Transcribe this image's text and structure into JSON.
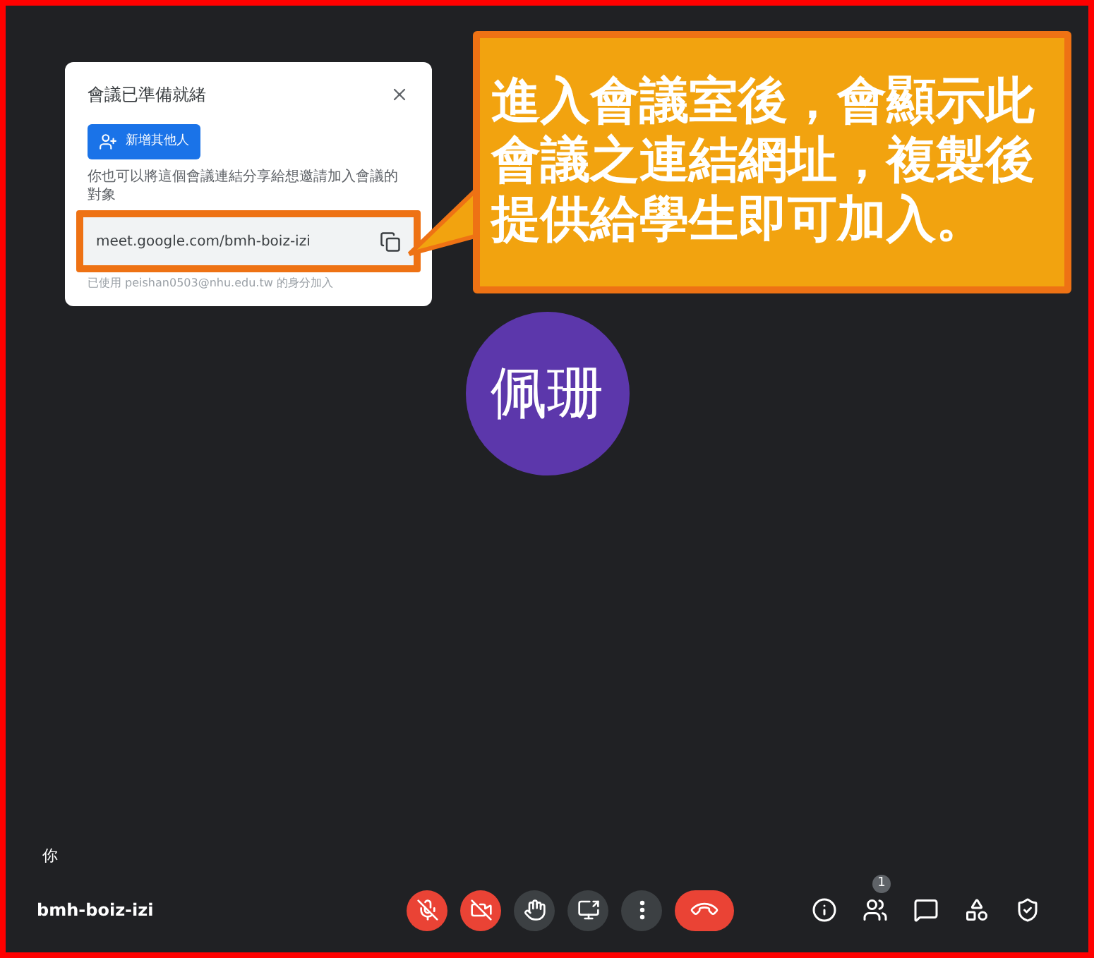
{
  "meeting_ready_card": {
    "title": "會議已準備就緒",
    "add_button": "新增其他人",
    "description": "你也可以將這個會議連結分享給想邀請加入會議的對象",
    "link": "meet.google.com/bmh-boiz-izi",
    "signed_in_note": "已使用 peishan0503@nhu.edu.tw 的身分加入"
  },
  "annotation": {
    "text": "進入會議室後，會顯示此會議之連結網址，複製後提供給學生即可加入。"
  },
  "avatar": {
    "initials": "佩珊"
  },
  "self_label": "你",
  "meeting_code": "bmh-boiz-izi",
  "controls": [
    {
      "kind": "mic",
      "on": false
    },
    {
      "kind": "camera",
      "on": false
    },
    {
      "kind": "hand"
    },
    {
      "kind": "present"
    },
    {
      "kind": "more"
    },
    {
      "kind": "leave"
    }
  ],
  "side_controls": [
    {
      "kind": "info"
    },
    {
      "kind": "people",
      "badge": "1"
    },
    {
      "kind": "chat"
    },
    {
      "kind": "activities"
    },
    {
      "kind": "host"
    }
  ]
}
